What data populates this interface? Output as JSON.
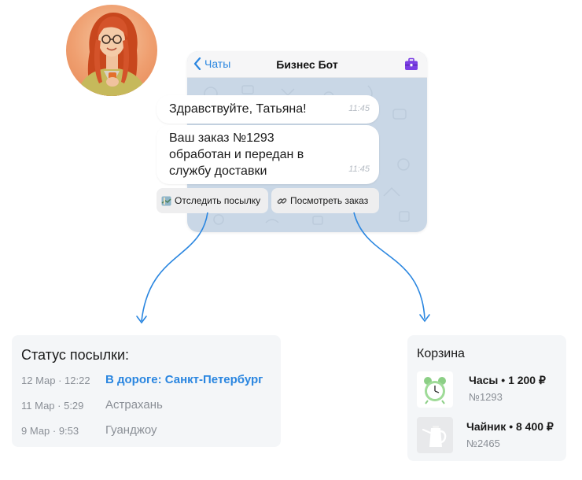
{
  "chat": {
    "back_label": "Чаты",
    "title": "Бизнес Бот",
    "messages": [
      {
        "text": "Здравствуйте, Татьяна!",
        "time": "11:45"
      },
      {
        "lines": [
          "Ваш заказ №1293",
          "обработан и передан в",
          "службу доставки"
        ],
        "time": "11:45"
      }
    ],
    "actions": [
      {
        "label": "Отследить посылку",
        "icon": "map-icon"
      },
      {
        "label": "Посмотреть заказ",
        "icon": "link-icon"
      }
    ]
  },
  "status": {
    "title": "Статус посылки:",
    "rows": [
      {
        "datetime": "12 Мар · 12:22",
        "place": "В дороге: Санкт-Петербург",
        "active": true
      },
      {
        "datetime": "11 Мар · 5:29",
        "place": "Астрахань",
        "active": false
      },
      {
        "datetime": "9 Мар · 9:53",
        "place": "Гуанджоу",
        "active": false
      }
    ]
  },
  "cart": {
    "title": "Корзина",
    "items": [
      {
        "name": "Часы",
        "price": "1 200 ₽",
        "number": "№1293",
        "icon": "alarm-clock-icon"
      },
      {
        "name": "Чайник",
        "price": "8 400 ₽",
        "number": "№2465",
        "icon": "kettle-icon"
      }
    ]
  },
  "colors": {
    "accent": "#2a86e0",
    "chat_bg": "#c9d7e6",
    "card_bg": "#f4f6f8",
    "briefcase": "#7b3fe4"
  }
}
